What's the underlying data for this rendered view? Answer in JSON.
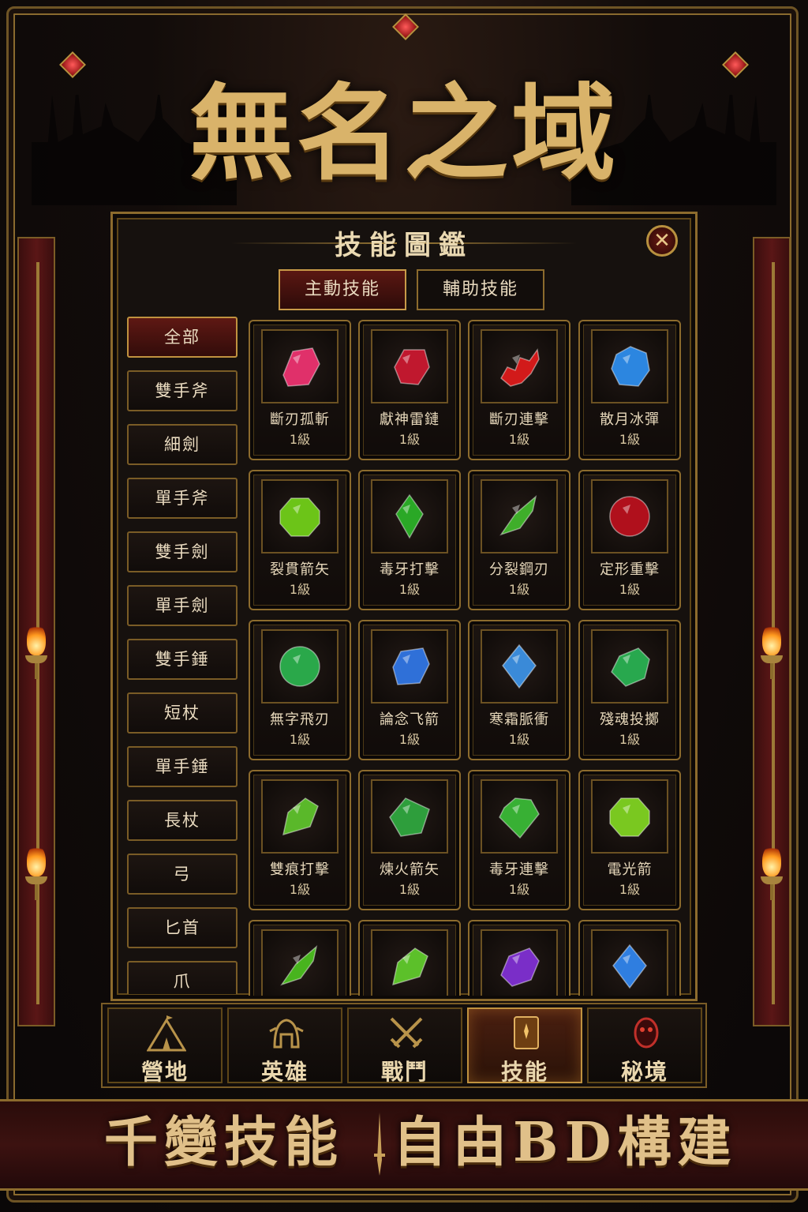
{
  "app": {
    "title": "無名之域"
  },
  "panel": {
    "title": "技能圖鑑",
    "close_icon": "close-icon"
  },
  "tabs": [
    {
      "label": "主動技能",
      "active": true
    },
    {
      "label": "輔助技能",
      "active": false
    }
  ],
  "categories": [
    {
      "label": "全部",
      "active": true
    },
    {
      "label": "雙手斧"
    },
    {
      "label": "細劍"
    },
    {
      "label": "單手斧"
    },
    {
      "label": "雙手劍"
    },
    {
      "label": "單手劍"
    },
    {
      "label": "雙手錘"
    },
    {
      "label": "短杖"
    },
    {
      "label": "單手錘"
    },
    {
      "label": "長杖"
    },
    {
      "label": "弓"
    },
    {
      "label": "匕首"
    },
    {
      "label": "爪"
    }
  ],
  "skills": [
    {
      "name": "斷刃孤斬",
      "level": "1級",
      "gem": "pink-ruby-gem",
      "color": "#e0306a"
    },
    {
      "name": "獻神雷鏈",
      "level": "1級",
      "gem": "red-ruby-gem",
      "color": "#c0182e"
    },
    {
      "name": "斷刃連擊",
      "level": "1級",
      "gem": "red-cluster-gem",
      "color": "#d21a1a"
    },
    {
      "name": "散月冰彈",
      "level": "1級",
      "gem": "blue-sapphire-gem",
      "color": "#2c86e0"
    },
    {
      "name": "裂貫箭矢",
      "level": "1級",
      "gem": "green-emerald-gem",
      "color": "#6cc418"
    },
    {
      "name": "毒牙打擊",
      "level": "1級",
      "gem": "green-crystal-gem",
      "color": "#2aa826"
    },
    {
      "name": "分裂鋼刃",
      "level": "1級",
      "gem": "green-shard-gem",
      "color": "#3fae2a"
    },
    {
      "name": "定形重擊",
      "level": "1級",
      "gem": "red-orb-gem",
      "color": "#b0101c"
    },
    {
      "name": "無字飛刃",
      "level": "1級",
      "gem": "gold-ring-gem",
      "color": "#2aa84a"
    },
    {
      "name": "論念飞箭",
      "level": "1級",
      "gem": "blue-oval-gem",
      "color": "#2f70d8"
    },
    {
      "name": "寒霜脈衝",
      "level": "1級",
      "gem": "blue-diamond-gem",
      "color": "#3a8ad8"
    },
    {
      "name": "殘魂投擲",
      "level": "1級",
      "gem": "green-rough-gem",
      "color": "#28a84e"
    },
    {
      "name": "雙痕打擊",
      "level": "1級",
      "gem": "green-leaf-gem",
      "color": "#5ab82a"
    },
    {
      "name": "煉火箭矢",
      "level": "1級",
      "gem": "green-slab-gem",
      "color": "#2e9e3c"
    },
    {
      "name": "毒牙連擊",
      "level": "1級",
      "gem": "green-cut-gem",
      "color": "#38b034"
    },
    {
      "name": "電光箭",
      "level": "1級",
      "gem": "green-emerald-gem",
      "color": "#7ac820"
    },
    {
      "name": "",
      "level": "",
      "gem": "green-shard-gem",
      "color": "#48b41e"
    },
    {
      "name": "",
      "level": "",
      "gem": "green-leaf-gem",
      "color": "#5cc02a"
    },
    {
      "name": "",
      "level": "",
      "gem": "purple-amethyst-gem",
      "color": "#7a2ec8"
    },
    {
      "name": "",
      "level": "",
      "gem": "blue-diamond-gem",
      "color": "#2f7ee0"
    }
  ],
  "nav": [
    {
      "label": "營地",
      "icon": "tent-icon",
      "active": false
    },
    {
      "label": "英雄",
      "icon": "helmet-icon",
      "active": false
    },
    {
      "label": "戰鬥",
      "icon": "crossed-swords-icon",
      "active": false
    },
    {
      "label": "技能",
      "icon": "spellbook-icon",
      "active": true
    },
    {
      "label": "秘境",
      "icon": "demon-portal-icon",
      "active": false
    }
  ],
  "banner": {
    "left": "千變技能",
    "right": "自由BD構建"
  }
}
